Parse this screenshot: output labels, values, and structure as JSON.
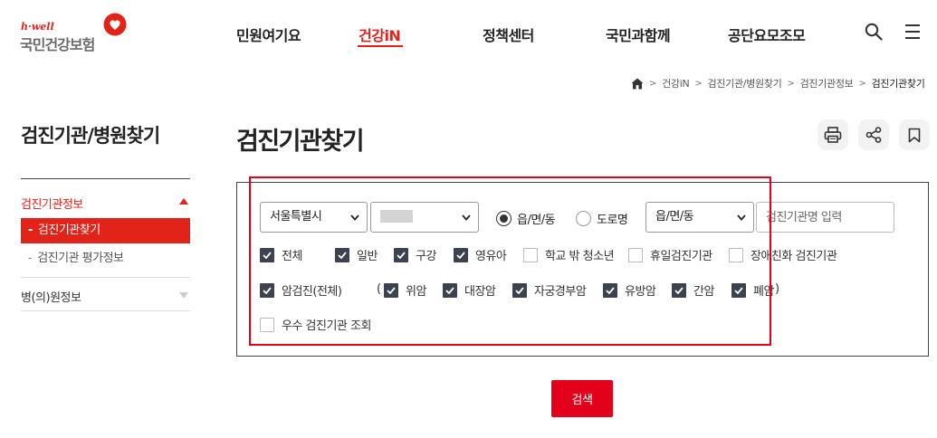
{
  "logo": {
    "tagline": "h·well",
    "org_name": "국민건강보험"
  },
  "gnb": {
    "items": [
      {
        "label": "민원여기요"
      },
      {
        "label": "건강iN",
        "active": true
      },
      {
        "label": "정책센터"
      },
      {
        "label": "국민과함께"
      },
      {
        "label": "공단요모조모"
      }
    ]
  },
  "breadcrumb": {
    "items": [
      "건강iN",
      "검진기관/병원찾기",
      "검진기관정보",
      "검진기관찾기"
    ]
  },
  "sidebar": {
    "title": "검진기관/병원찾기",
    "groups": [
      {
        "label": "검진기관정보",
        "expanded": true,
        "items": [
          {
            "label": "검진기관찾기",
            "active": true
          },
          {
            "label": "검진기관 평가정보"
          }
        ]
      },
      {
        "label": "병(의)원정보",
        "expanded": false
      }
    ]
  },
  "main": {
    "title": "검진기관찾기",
    "tools": [
      "print-icon",
      "share-icon",
      "bookmark-icon"
    ]
  },
  "search": {
    "region_select": "서울특별시",
    "district_select": "",
    "address_type": {
      "options": [
        "읍/면/동",
        "도로명"
      ],
      "selected": "읍/면/동"
    },
    "town_select": "읍/면/동",
    "name_input_placeholder": "검진기관명 입력",
    "types": [
      {
        "label": "전체",
        "checked": true
      },
      {
        "label": "일반",
        "checked": true
      },
      {
        "label": "구강",
        "checked": true
      },
      {
        "label": "영유아",
        "checked": true
      },
      {
        "label": "학교 밖 청소년",
        "checked": false
      },
      {
        "label": "휴일검진기관",
        "checked": false
      },
      {
        "label": "장애친화 검진기관",
        "checked": false
      }
    ],
    "cancer_all": {
      "label": "암검진(전체)",
      "checked": true
    },
    "cancer_paren_open": "(",
    "cancer_paren_close": ")",
    "cancers": [
      {
        "label": "위암",
        "checked": true
      },
      {
        "label": "대장암",
        "checked": true
      },
      {
        "label": "자궁경부암",
        "checked": true
      },
      {
        "label": "유방암",
        "checked": true
      },
      {
        "label": "간암",
        "checked": true
      },
      {
        "label": "폐암",
        "checked": true
      }
    ],
    "excellent": {
      "label": "우수 검진기관 조회",
      "checked": false
    },
    "submit_label": "검색"
  },
  "colors": {
    "accent": "#e2231a",
    "checkbox_checked": "#3c4250",
    "highlight": "#e2001a"
  }
}
